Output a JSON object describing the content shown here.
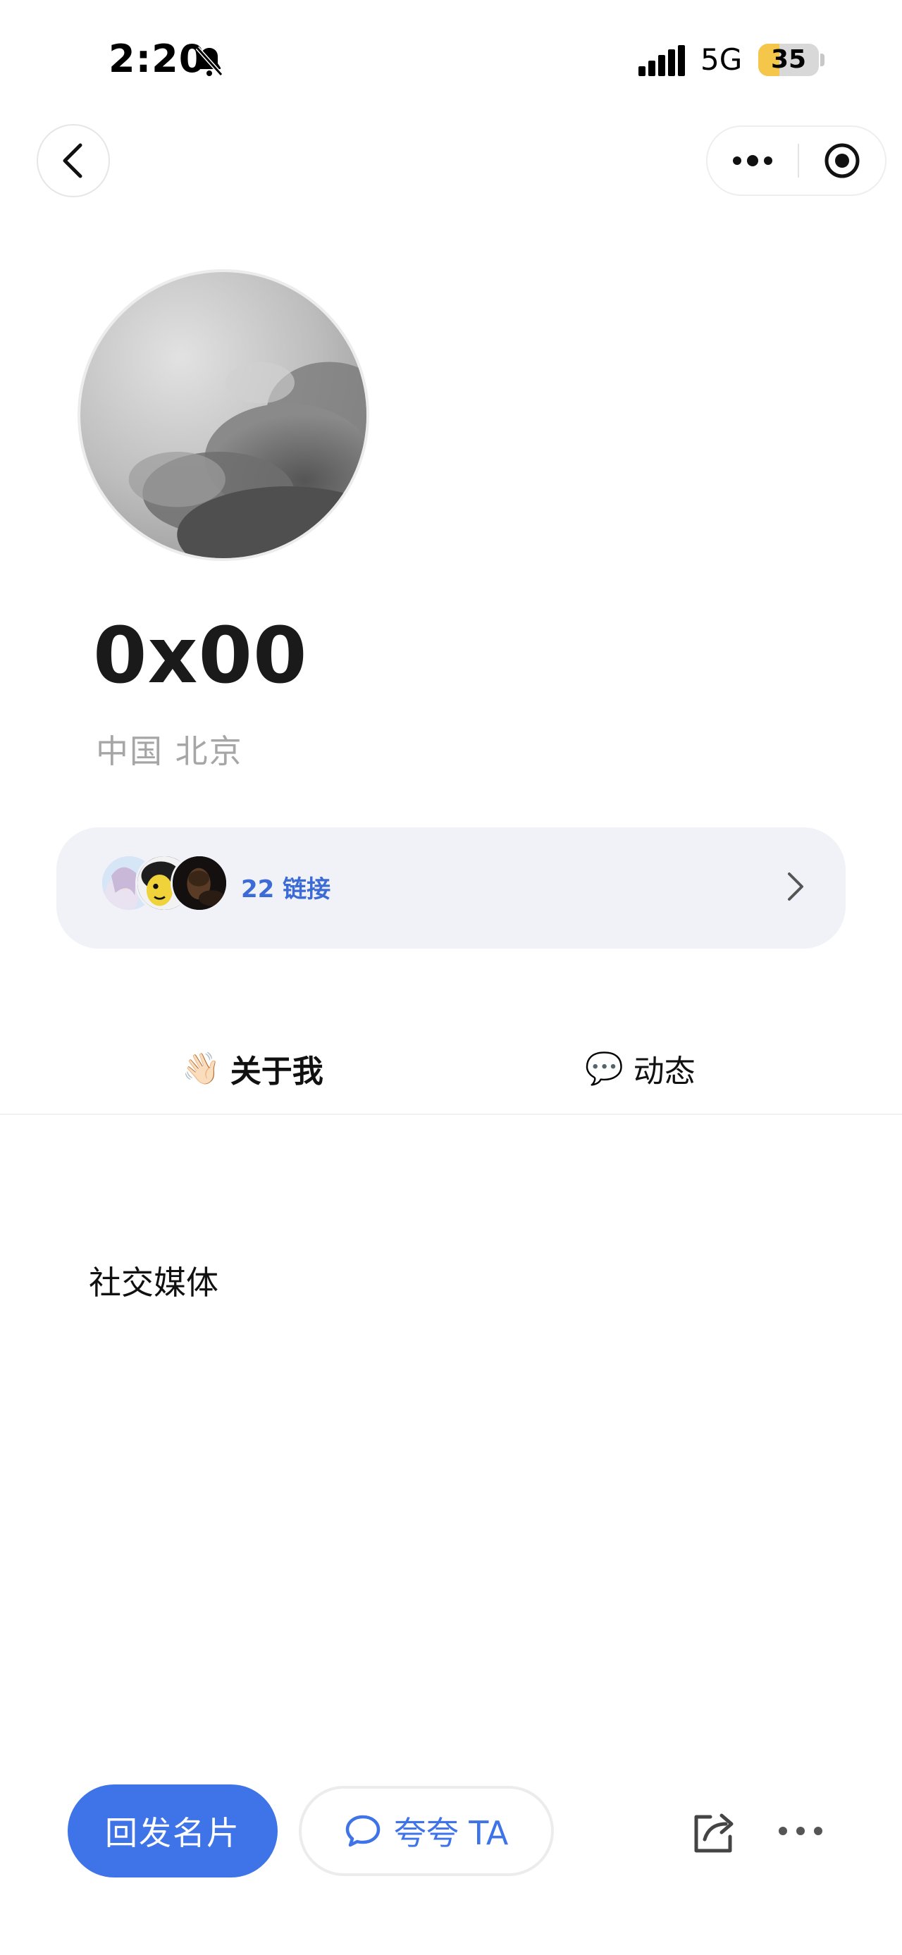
{
  "status_bar": {
    "time": "2:20",
    "network": "5G",
    "battery_level": "35",
    "battery_fraction": 0.35
  },
  "nav": {
    "back_icon": "chevron-left-icon",
    "more_icon": "more-dots-icon",
    "target_icon": "close-target-icon"
  },
  "profile": {
    "name": "0x00",
    "location": "中国 北京"
  },
  "links": {
    "label": "22 链接"
  },
  "tabs": [
    {
      "emoji": "👋🏻",
      "label": "关于我"
    },
    {
      "emoji": "💬",
      "label": "动态"
    }
  ],
  "section": {
    "title": "社交媒体"
  },
  "bottom_bar": {
    "send_card_label": "回发名片",
    "praise_label": "夸夸 TA"
  },
  "colors": {
    "accent": "#3f74e8",
    "link_text": "#3d6bd6",
    "card_bg": "#f0f2f7",
    "muted_text": "#a6a6a6"
  }
}
